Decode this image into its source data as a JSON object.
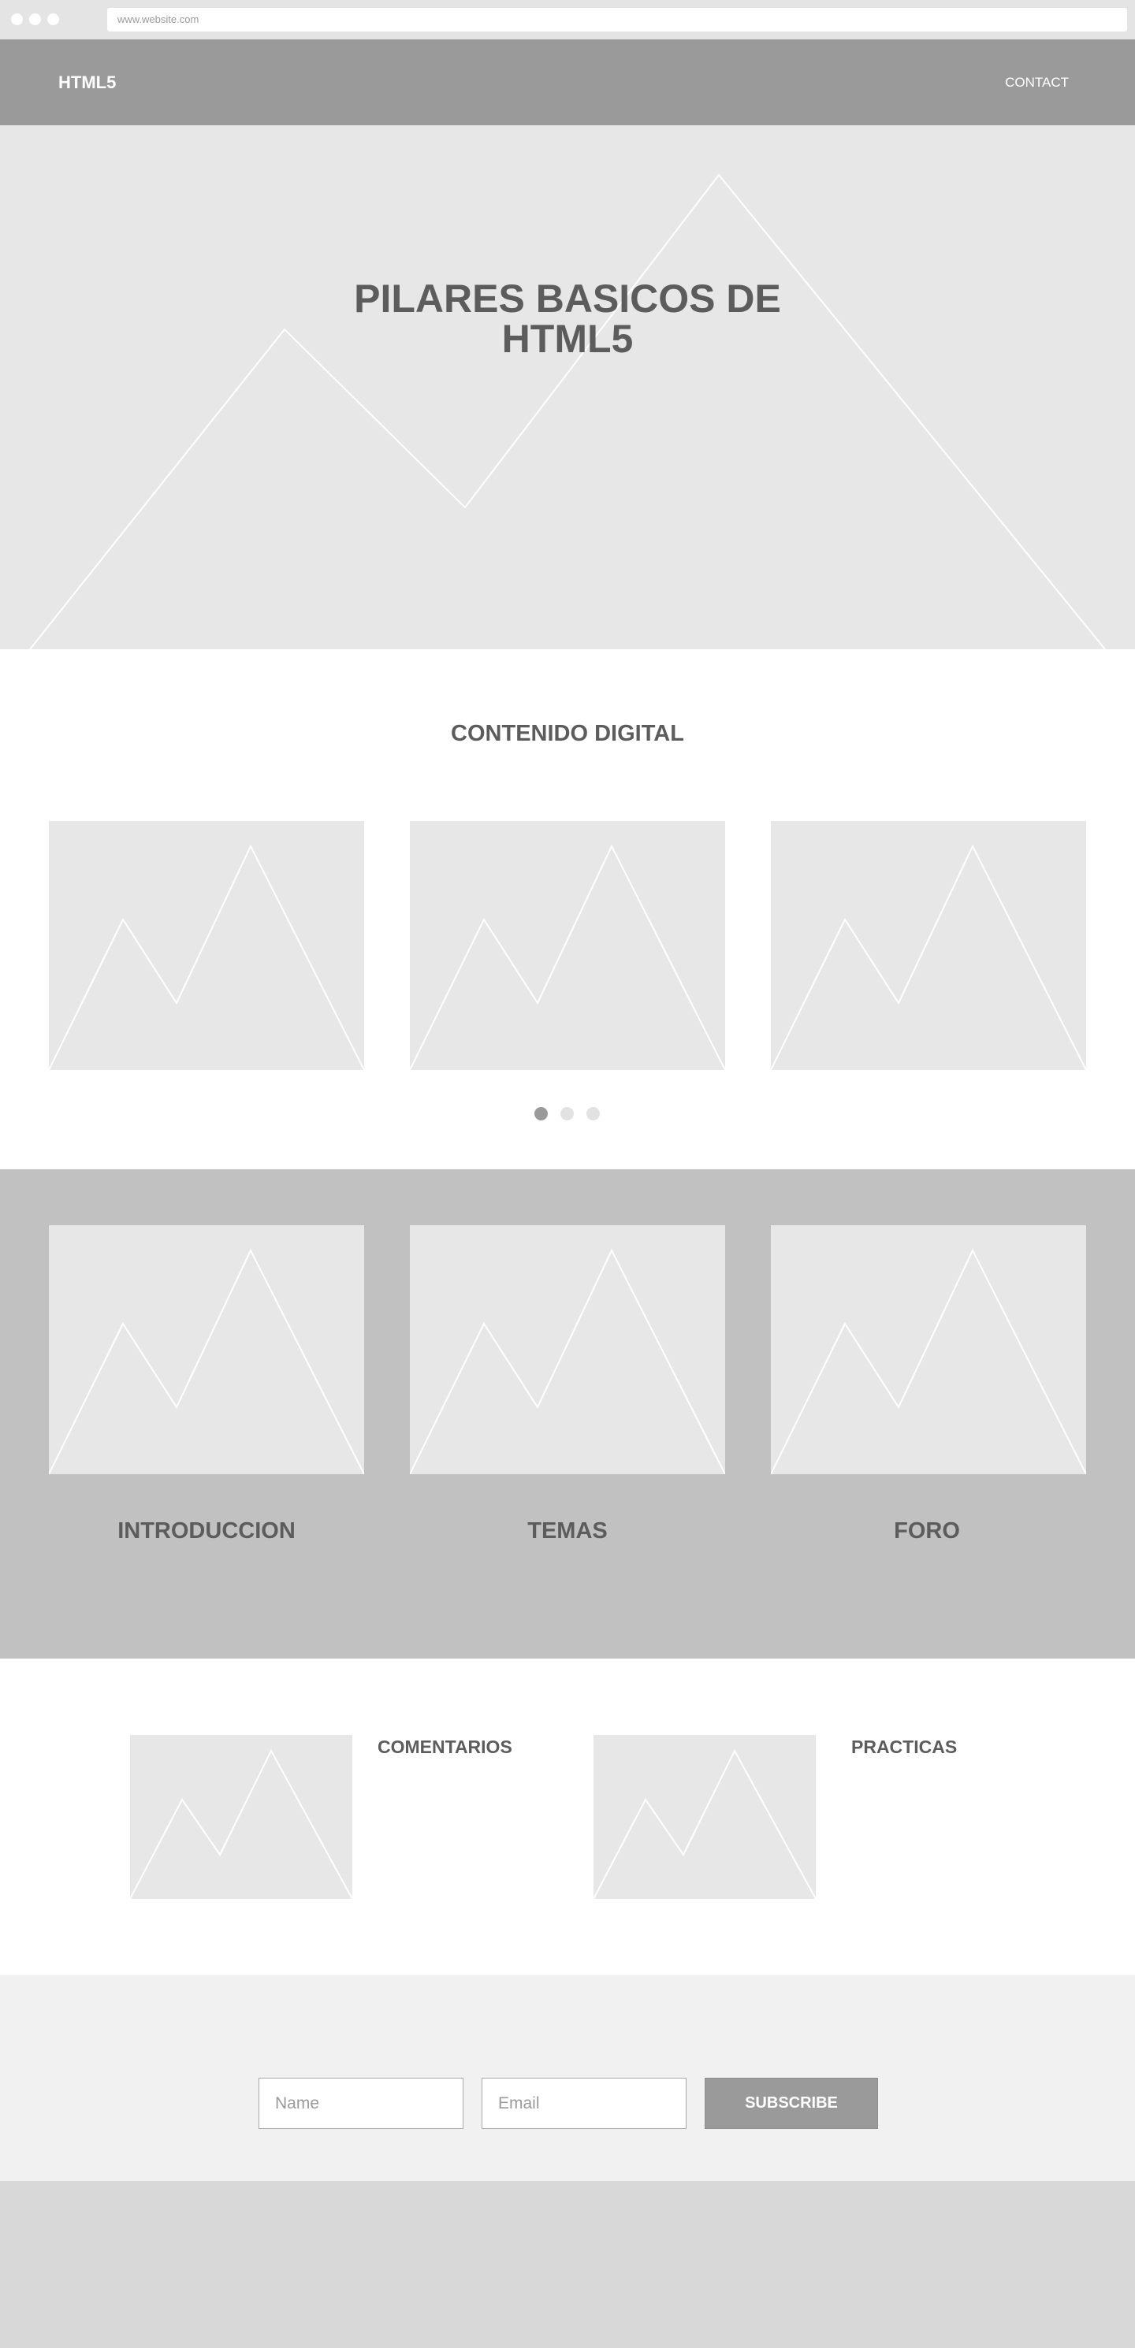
{
  "browser": {
    "url": "www.website.com",
    "window_dots": [
      "close-dot",
      "minimize-dot",
      "maximize-dot"
    ]
  },
  "header": {
    "logo": "HTML5",
    "nav": {
      "contact_label": "CONTACT"
    }
  },
  "hero": {
    "title": "PILARES BASICOS DE HTML5",
    "image_icon": "mountain-placeholder-icon"
  },
  "content_section": {
    "title": "CONTENIDO DIGITAL",
    "carousel": {
      "slide_count": 3,
      "active_index": 0,
      "dot_colors": {
        "active": "#9a9a9a",
        "inactive": "#e2e2e2"
      }
    }
  },
  "feature_cards": [
    {
      "label": "INTRODUCCION"
    },
    {
      "label": "TEMAS"
    },
    {
      "label": "FORO"
    }
  ],
  "media_blocks": [
    {
      "label": "COMENTARIOS"
    },
    {
      "label": "PRACTICAS"
    }
  ],
  "subscribe": {
    "name_placeholder": "Name",
    "email_placeholder": "Email",
    "button_label": "SUBSCRIBE"
  },
  "colors": {
    "header_bg": "#9a9a9a",
    "placeholder_bg": "#e7e7e7",
    "band_bg": "#c1c1c1",
    "subscribe_bg": "#f1f1f1",
    "footer_bg": "#d8d8d8",
    "text": "#5c5c5c"
  }
}
